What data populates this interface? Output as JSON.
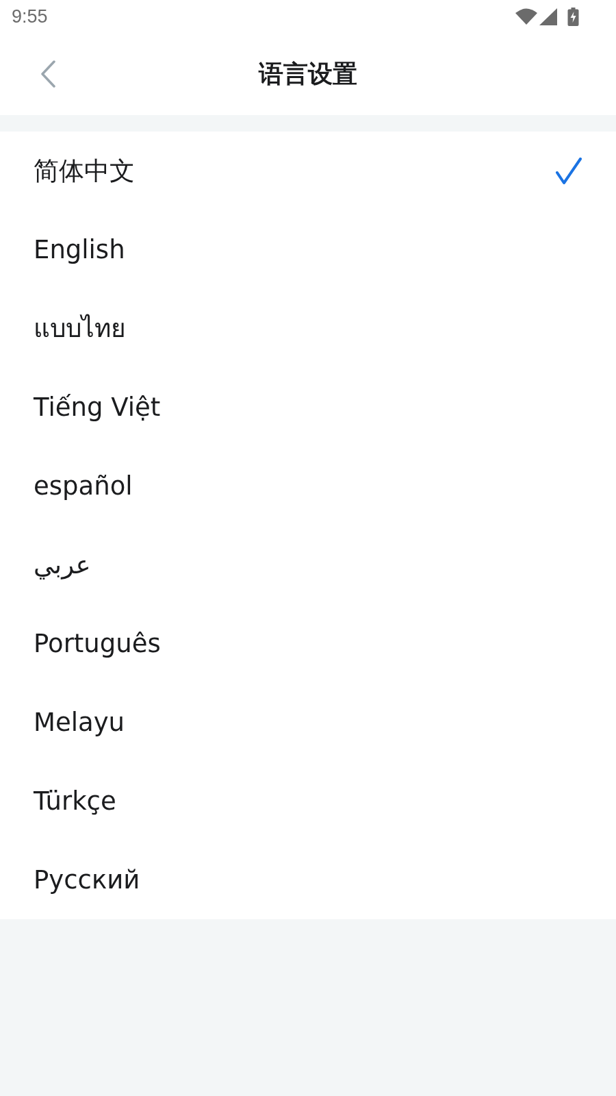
{
  "status_bar": {
    "time": "9:55"
  },
  "header": {
    "title": "语言设置"
  },
  "languages": [
    {
      "label": "简体中文",
      "selected": true
    },
    {
      "label": "English",
      "selected": false
    },
    {
      "label": "แบบไทย",
      "selected": false
    },
    {
      "label": "Tiếng Việt",
      "selected": false
    },
    {
      "label": "español",
      "selected": false
    },
    {
      "label": "عربي",
      "selected": false
    },
    {
      "label": "Português",
      "selected": false
    },
    {
      "label": "Melayu",
      "selected": false
    },
    {
      "label": "Türkçe",
      "selected": false
    },
    {
      "label": "Русский",
      "selected": false
    }
  ]
}
